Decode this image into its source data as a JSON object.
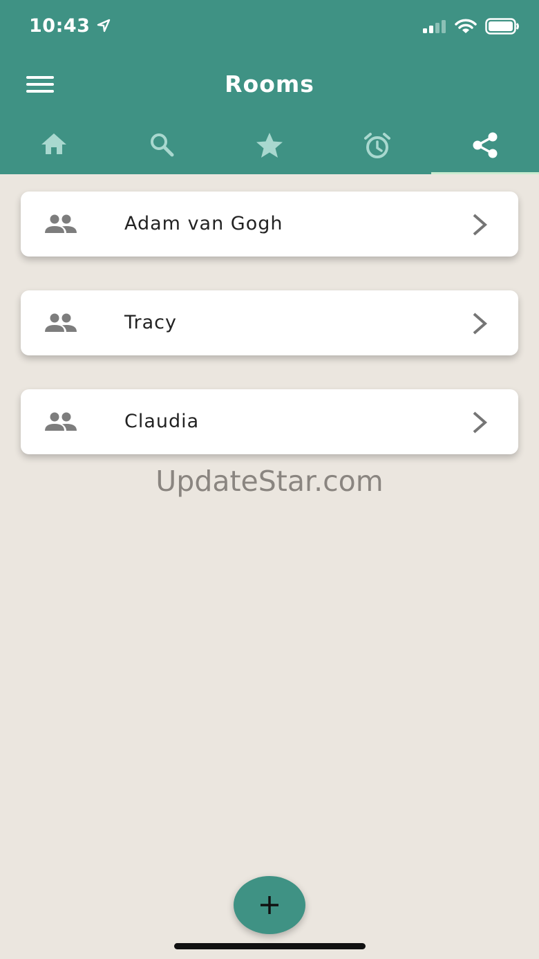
{
  "status_bar": {
    "time": "10:43"
  },
  "header": {
    "title": "Rooms"
  },
  "tabs": [
    {
      "icon": "home-icon",
      "active": false
    },
    {
      "icon": "search-icon",
      "active": false
    },
    {
      "icon": "star-icon",
      "active": false
    },
    {
      "icon": "alarm-icon",
      "active": false
    },
    {
      "icon": "share-icon",
      "active": true
    }
  ],
  "rooms": [
    {
      "name": "Adam van Gogh",
      "icon": "people-icon"
    },
    {
      "name": "Tracy",
      "icon": "people-icon"
    },
    {
      "name": "Claudia",
      "icon": "people-icon"
    }
  ],
  "watermark": "UpdateStar.com",
  "colors": {
    "primary": "#3f9284",
    "background": "#ebe6df",
    "tab_icon": "#a9d8cf",
    "active_tab_indicator": "#c9ecd0"
  }
}
